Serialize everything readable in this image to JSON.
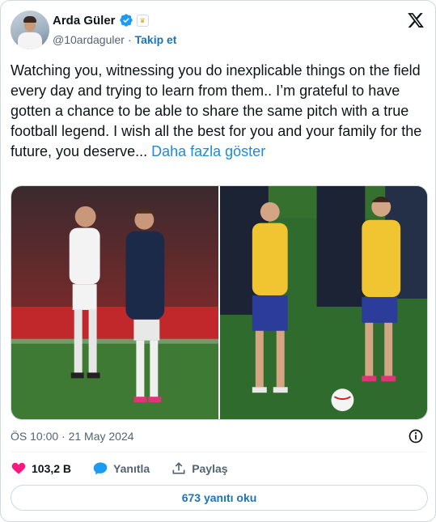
{
  "author": {
    "name": "Arda Güler",
    "handle": "@10ardaguler",
    "follow_label": "Takip et",
    "separator": "·"
  },
  "tweet": {
    "text": "Watching you, witnessing you do inexplicable things on the field every day and trying to learn from them.. I’m grateful to have gotten a chance to be able to share the same pitch with a true football legend. I wish all the best for you and your family for the future, you deserve...",
    "show_more": "Daha fazla göster",
    "timestamp": "ÖS 10:00 · 21 May 2024"
  },
  "actions": {
    "likes": "103,2 B",
    "reply_label": "Yanıtla",
    "share_label": "Paylaş"
  },
  "replies_button": "673 yanıtı oku",
  "icons": [
    "verified-icon",
    "club-crest-icon",
    "x-logo-icon",
    "info-icon",
    "heart-icon",
    "reply-bubble-icon",
    "share-icon"
  ],
  "colors": {
    "accent": "#1d9bf0",
    "like": "#f91880",
    "follow": "#1d73b8"
  }
}
